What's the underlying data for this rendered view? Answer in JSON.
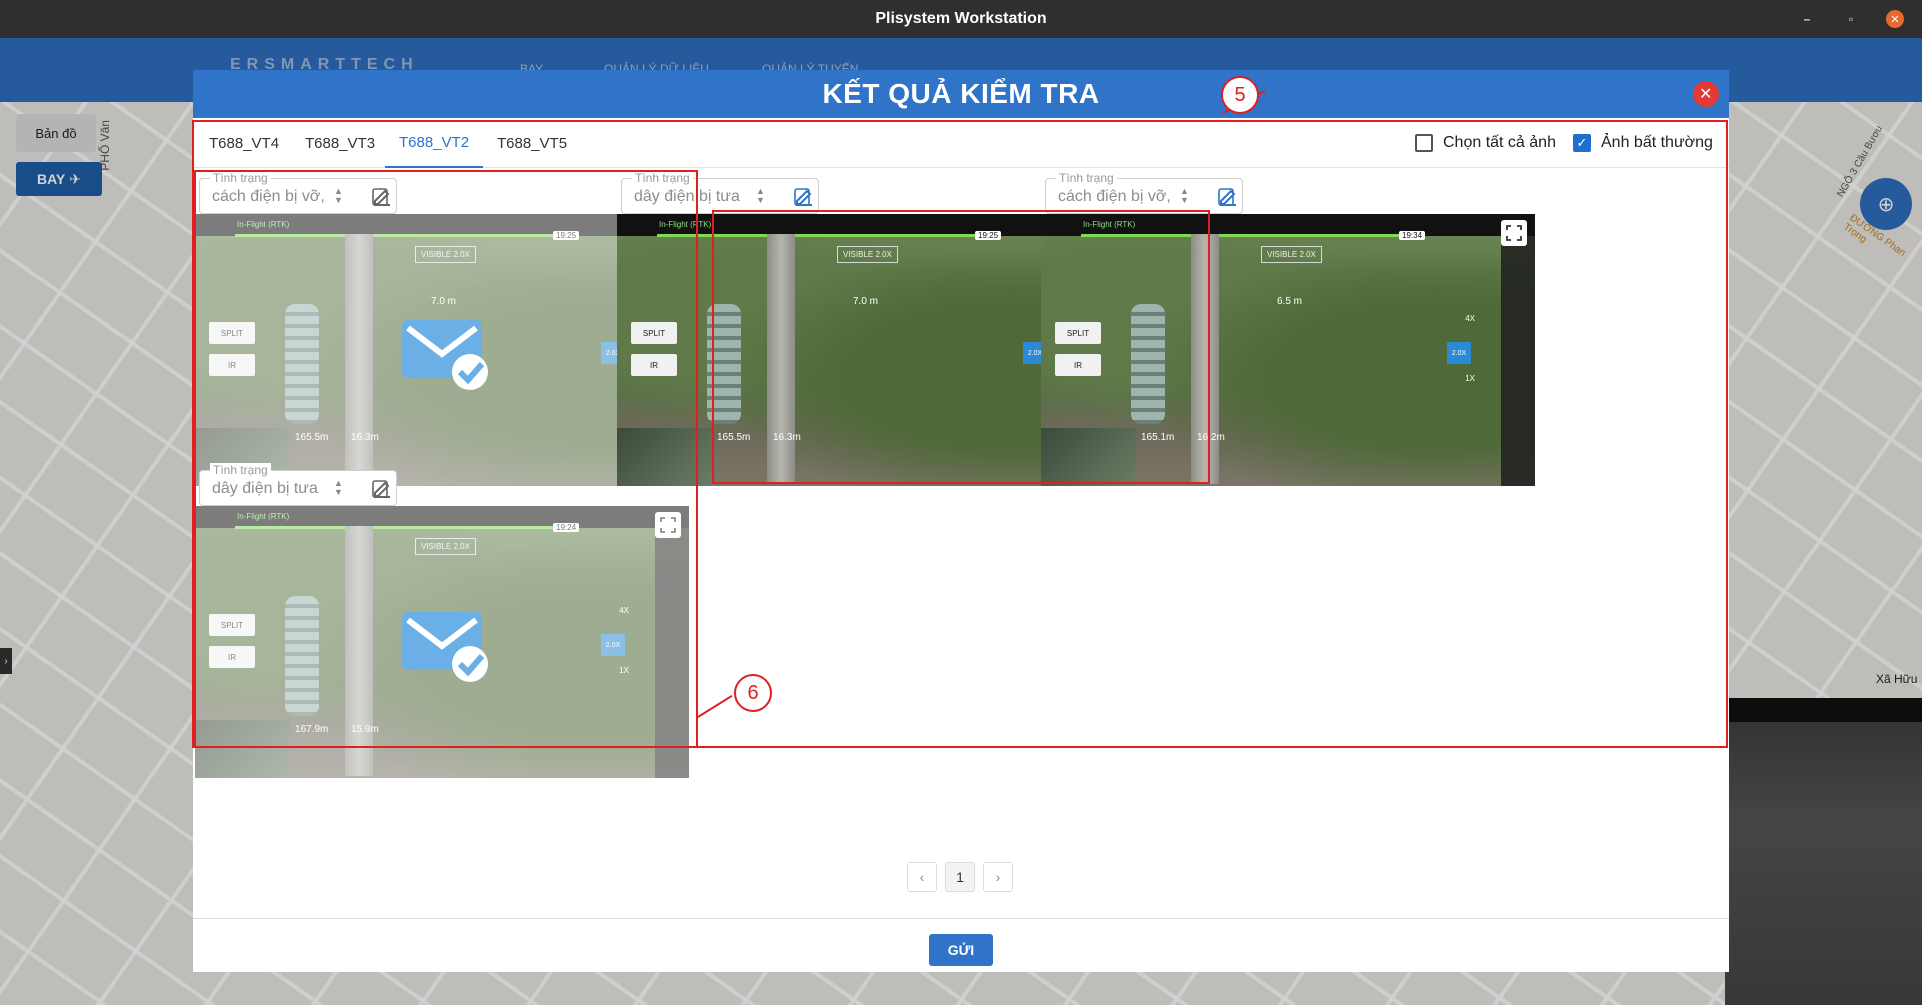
{
  "window": {
    "title": "Plisystem Workstation"
  },
  "app": {
    "logo": "ERSMARTTECH",
    "menu": [
      "BAY",
      "QUẢN LÝ DỮ LIỆU",
      "QUẢN LÝ TUYẾN"
    ],
    "map_tab": "Bản đồ",
    "bay_button": "BAY",
    "street_label": "PHỐ Văn",
    "map_place": "Xã Hữu",
    "map_road_1": "NGÕ 3 Cầu Bươu",
    "map_road_2": "ĐƯỜNG Phan Trọng"
  },
  "modal": {
    "title": "KẾT QUẢ KIỂM TRA",
    "tabs": [
      "T688_VT4",
      "T688_VT3",
      "T688_VT2",
      "T688_VT5"
    ],
    "active_tab": "T688_VT2",
    "select_all_label": "Chọn tất cả ảnh",
    "select_all_checked": false,
    "abnormal_label": "Ảnh bất thường",
    "abnormal_checked": true,
    "status_label": "Tình trạng",
    "cards": [
      {
        "status": "cách điện bị vỡ,",
        "distance": "7.0 m",
        "time": "19:25",
        "height": "165.5m",
        "speed": "16.3m",
        "checked": true
      },
      {
        "status": "dây điện bị tưa",
        "distance": "7.0 m",
        "time": "19:25",
        "height": "165.5m",
        "speed": "16.3m",
        "checked": false
      },
      {
        "status": "cách điện bị vỡ,",
        "distance": "6.5 m",
        "time": "19:34",
        "height": "165.1m",
        "speed": "16.2m",
        "checked": false
      },
      {
        "status": "dây điện bị tưa",
        "distance": "",
        "time": "19:24",
        "height": "167.9m",
        "speed": "15.9m",
        "checked": true
      }
    ],
    "overlay_texts": {
      "mode": "In-Flight (RTK)",
      "visible": "VISIBLE 2.0X",
      "split": "SPLIT",
      "ir": "IR",
      "zoom": "2.0X",
      "zoom_4x": "4X",
      "zoom_1x": "1X"
    },
    "callouts": [
      "5",
      "6"
    ],
    "pager": {
      "prev": "‹",
      "current": "1",
      "next": "›"
    },
    "send_button": "GỬI"
  },
  "colors": {
    "primary": "#2f74c9",
    "annotation": "#e02020",
    "close": "#e53935"
  }
}
